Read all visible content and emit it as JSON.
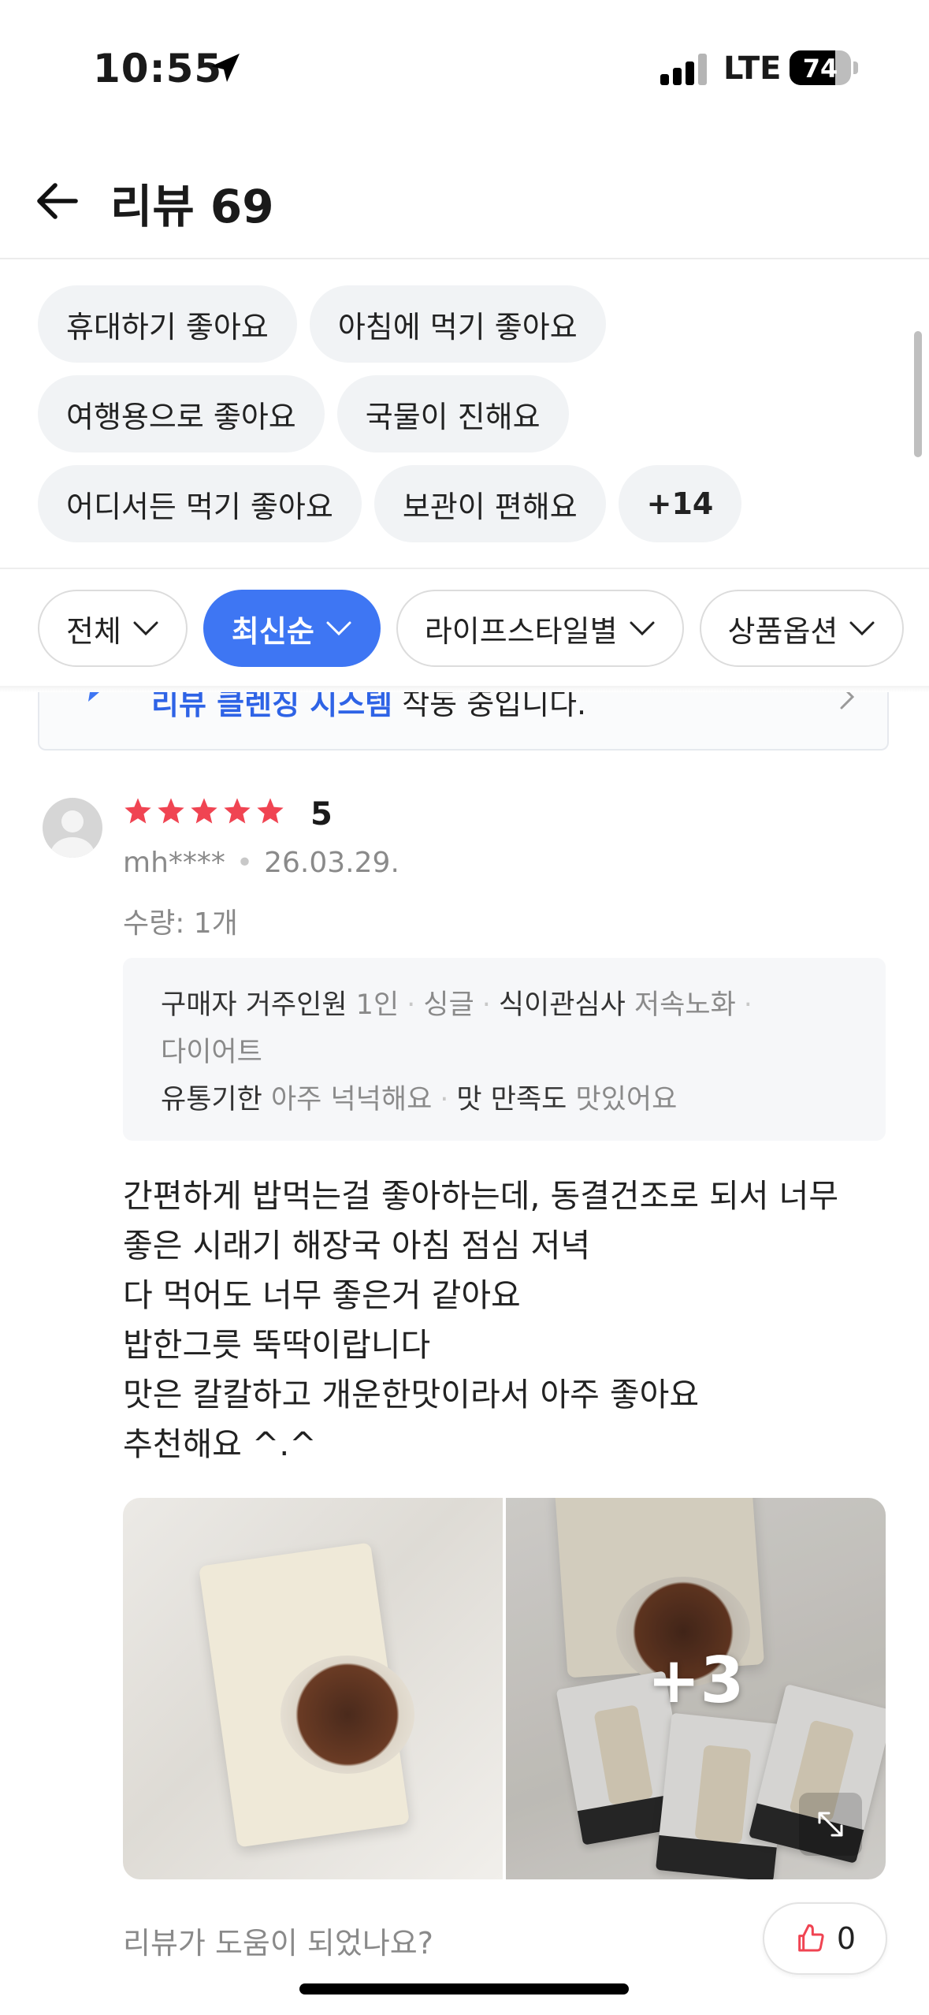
{
  "status_bar": {
    "time": "10:55",
    "network": "LTE",
    "battery": "74",
    "battery_level": 0.74
  },
  "header": {
    "title": "리뷰 69"
  },
  "keywords": [
    [
      "휴대하기 좋아요",
      "아침에 먹기 좋아요"
    ],
    [
      "여행용으로 좋아요",
      "국물이 진해요"
    ],
    [
      "어디서든 먹기 좋아요",
      "보관이 편해요",
      "+14"
    ]
  ],
  "filters": [
    {
      "label": "전체",
      "active": false
    },
    {
      "label": "최신순",
      "active": true
    },
    {
      "label": "라이프스타일별",
      "active": false
    },
    {
      "label": "상품옵션",
      "active": false
    }
  ],
  "notice": {
    "highlight": "리뷰 클렌징 시스템",
    "rest": " 작동 중입니다."
  },
  "review": {
    "rating": 5,
    "score_label": "5",
    "user": "mh****",
    "date": "26.03.29.",
    "quantity": "수량: 1개",
    "info": {
      "line1": [
        {
          "k": "구매자 거주인원",
          "v": "1인"
        },
        {
          "k": "",
          "v": "싱글"
        },
        {
          "k": "식이관심사",
          "v": "저속노화"
        }
      ],
      "line1_trailing_sep": "·",
      "line2": "다이어트",
      "line3": [
        {
          "k": "유통기한",
          "v": "아주 넉넉해요"
        },
        {
          "k": "맛 만족도",
          "v": "맛있어요"
        }
      ]
    },
    "text": [
      "간편하게 밥먹는걸 좋아하는데, 동결건조로 되서 너무",
      "좋은 시래기 해장국 아침 점심 저녁",
      "다 먹어도 너무 좋은거 같아요",
      "밥한그릇 뚝딱이랍니다",
      "맛은 칼칼하고 개운한맛이라서 아주 좋아요",
      "추천해요 ^.^"
    ],
    "photos_more": "+3",
    "helpful_question": "리뷰가 도움이 되었나요?",
    "like_count": "0"
  },
  "colors": {
    "accent": "#3e76f3",
    "star": "#f04452",
    "like_icon": "#f04452"
  }
}
